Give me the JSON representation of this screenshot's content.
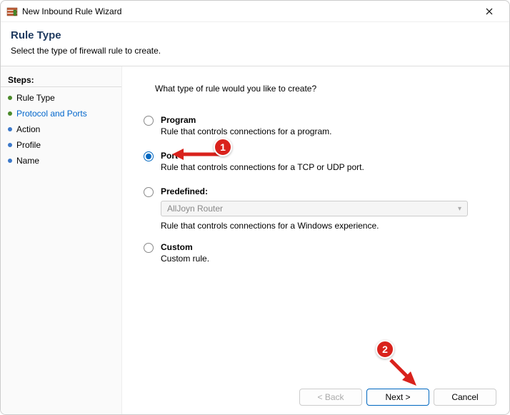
{
  "window": {
    "title": "New Inbound Rule Wizard"
  },
  "header": {
    "title": "Rule Type",
    "subtitle": "Select the type of firewall rule to create."
  },
  "sidebar": {
    "heading": "Steps:",
    "items": [
      {
        "label": "Rule Type"
      },
      {
        "label": "Protocol and Ports"
      },
      {
        "label": "Action"
      },
      {
        "label": "Profile"
      },
      {
        "label": "Name"
      }
    ]
  },
  "content": {
    "question": "What type of rule would you like to create?",
    "options": {
      "program": {
        "title": "Program",
        "desc": "Rule that controls connections for a program."
      },
      "port": {
        "title": "Port",
        "desc": "Rule that controls connections for a TCP or UDP port."
      },
      "predefined": {
        "title": "Predefined:",
        "dropdown_value": "AllJoyn Router",
        "desc": "Rule that controls connections for a Windows experience."
      },
      "custom": {
        "title": "Custom",
        "desc": "Custom rule."
      }
    }
  },
  "buttons": {
    "back": "< Back",
    "next": "Next >",
    "cancel": "Cancel"
  },
  "annotations": {
    "badge1": "1",
    "badge2": "2"
  }
}
